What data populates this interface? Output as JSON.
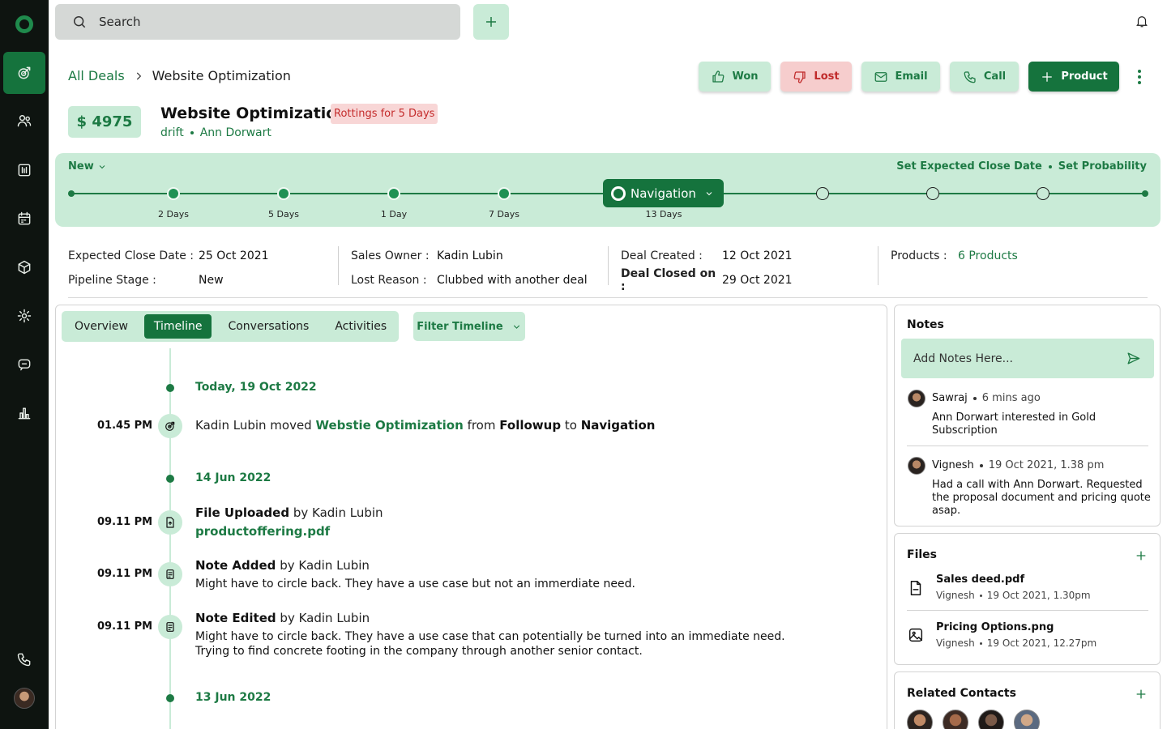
{
  "sidebar": {
    "items": [
      {
        "icon": "deals-icon"
      },
      {
        "icon": "contacts-icon"
      },
      {
        "icon": "companies-icon"
      },
      {
        "icon": "calendar-icon"
      },
      {
        "icon": "products-icon"
      },
      {
        "icon": "settings-icon"
      },
      {
        "icon": "chat-icon"
      },
      {
        "icon": "reports-icon"
      },
      {
        "icon": "phone-icon"
      }
    ]
  },
  "topbar": {
    "search_placeholder": "Search"
  },
  "breadcrumb": {
    "parent": "All Deals",
    "current": "Website Optimization"
  },
  "actions": {
    "won": "Won",
    "lost": "Lost",
    "email": "Email",
    "call": "Call",
    "product": "Product"
  },
  "deal": {
    "amount": "$ 4975",
    "title": "Website Optimization",
    "rotting": "Rottings for 5 Days",
    "company": "drift",
    "contact": "Ann Dorwart"
  },
  "pipeline": {
    "stage": "New",
    "set_close": "Set Expected Close Date",
    "set_prob": "Set Probability",
    "current_stage": "Navigation",
    "labels": [
      "2 Days",
      "5 Days",
      "1 Day",
      "7 Days",
      "13 Days"
    ]
  },
  "info": {
    "close_date_label": "Expected Close Date :",
    "close_date": "25 Oct 2021",
    "pipeline_stage_label": "Pipeline Stage :",
    "pipeline_stage": "New",
    "owner_label": "Sales Owner :",
    "owner": "Kadin Lubin",
    "lost_reason_label": "Lost Reason :",
    "lost_reason": "Clubbed with another deal",
    "created_label": "Deal Created :",
    "created": "12 Oct 2021",
    "closed_label": "Deal Closed on :",
    "closed": "29 Oct 2021",
    "products_label": "Products :",
    "products": "6 Products"
  },
  "tabs": [
    "Overview",
    "Timeline",
    "Conversations",
    "Activities"
  ],
  "filter_label": "Filter Timeline",
  "timeline": {
    "date1": "Today, 19 Oct 2022",
    "e1_time": "01.45 PM",
    "e1_actor": "Kadin Lubin moved",
    "e1_deal": "Webstie Optimization",
    "e1_from": "from",
    "e1_src": "Followup",
    "e1_to": "to",
    "e1_dst": "Navigation",
    "date2": "14 Jun 2022",
    "e2_time": "09.11 PM",
    "e2_title": "File Uploaded",
    "e2_by": "by Kadin Lubin",
    "e2_file": "productoffering.pdf",
    "e3_time": "09.11 PM",
    "e3_title": "Note Added",
    "e3_by": "by Kadin Lubin",
    "e3_body": "Might have to circle back. They have a use case but not an immerdiate need.",
    "e4_time": "09.11 PM",
    "e4_title": "Note Edited",
    "e4_by": "by Kadin Lubin",
    "e4_body": "Might have to circle back. They have a use case that can potentially be turned into an immediate need. Trying to find concrete footing in the company through another senior contact.",
    "date3": "13 Jun 2022"
  },
  "notes": {
    "title": "Notes",
    "placeholder": "Add Notes Here...",
    "items": [
      {
        "author": "Sawraj",
        "time": "6 mins ago",
        "text": "Ann Dorwart interested in Gold Subscription"
      },
      {
        "author": "Vignesh",
        "time": "19 Oct 2021, 1.38 pm",
        "text": "Had a call with Ann Dorwart. Requested the proposal document and pricing quote asap."
      }
    ]
  },
  "files": {
    "title": "Files",
    "items": [
      {
        "name": "Sales deed.pdf",
        "author": "Vignesh",
        "time": "19 Oct 2021, 1.30pm"
      },
      {
        "name": "Pricing Options.png",
        "author": "Vignesh",
        "time": "19 Oct 2021, 12.27pm"
      }
    ]
  },
  "related": {
    "title": "Related Contacts"
  }
}
